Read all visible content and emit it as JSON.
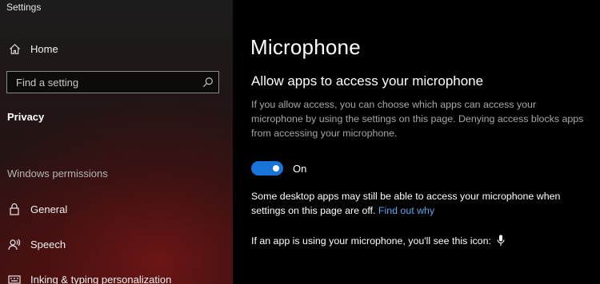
{
  "window": {
    "title": "Settings"
  },
  "sidebar": {
    "home": {
      "label": "Home",
      "icon": "home-icon"
    },
    "search": {
      "placeholder": "Find a setting",
      "icon": "search-icon"
    },
    "section_title": "Privacy",
    "group_label": "Windows permissions",
    "items": [
      {
        "label": "General",
        "icon": "lock-icon"
      },
      {
        "label": "Speech",
        "icon": "speech-icon"
      },
      {
        "label": "Inking & typing personalization",
        "icon": "inking-icon"
      }
    ]
  },
  "main": {
    "title": "Microphone",
    "heading": "Allow apps to access your microphone",
    "description": "If you allow access, you can choose which apps can access your microphone by using the settings on this page. Denying access blocks apps from accessing your microphone.",
    "toggle": {
      "state": "On",
      "checked": true
    },
    "note_text": "Some desktop apps may still be able to access your microphone when settings on this page are off. ",
    "note_link": "Find out why",
    "icon_note": "If an app is using your microphone, you'll see this icon:"
  },
  "colors": {
    "accent": "#1a73d9",
    "link": "#5aa7f2",
    "background": "#000000"
  }
}
